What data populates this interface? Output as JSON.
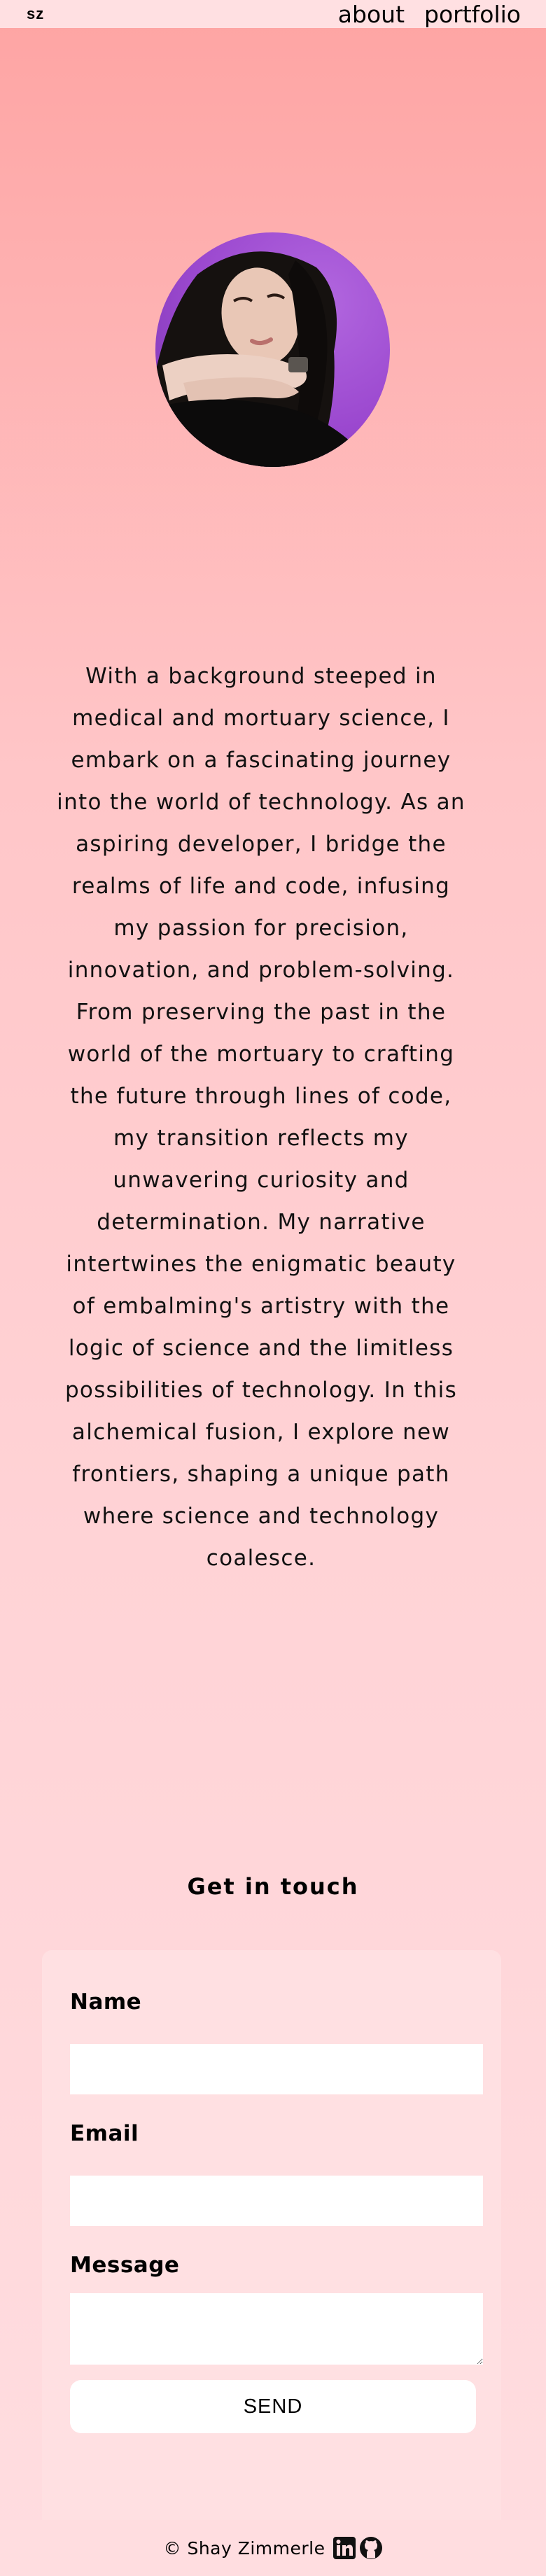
{
  "header": {
    "logo": "sz",
    "nav": [
      {
        "label": "about"
      },
      {
        "label": "portfolio"
      }
    ]
  },
  "profile": {
    "avatar_icon": "person-portrait-photo",
    "bio": "With a background steeped in medical and mortuary science, I embark on a fascinating journey into the world of technology. As an aspiring developer, I bridge the realms of life and code, infusing my passion for precision, innovation, and problem-solving. From preserving the past in the world of the mortuary to crafting the future through lines of code, my transition reflects my unwavering curiosity and determination. My narrative intertwines the enigmatic beauty of embalming's artistry with the logic of science and the limitless possibilities of technology. In this alchemical fusion, I explore new frontiers, shaping a unique path where science and technology coalesce."
  },
  "contact": {
    "title": "Get in touch",
    "name_label": "Name",
    "name_value": "",
    "email_label": "Email",
    "email_value": "",
    "message_label": "Message",
    "message_value": "",
    "send_label": "SEND"
  },
  "footer": {
    "copyright": "© Shay Zimmerle",
    "icons": [
      "linkedin-icon",
      "github-icon"
    ]
  },
  "colors": {
    "background_top": "#fea4a3",
    "background_bottom": "#ffdde0",
    "card": "#ffe0e2",
    "avatar_bg": "#9b48cf"
  }
}
